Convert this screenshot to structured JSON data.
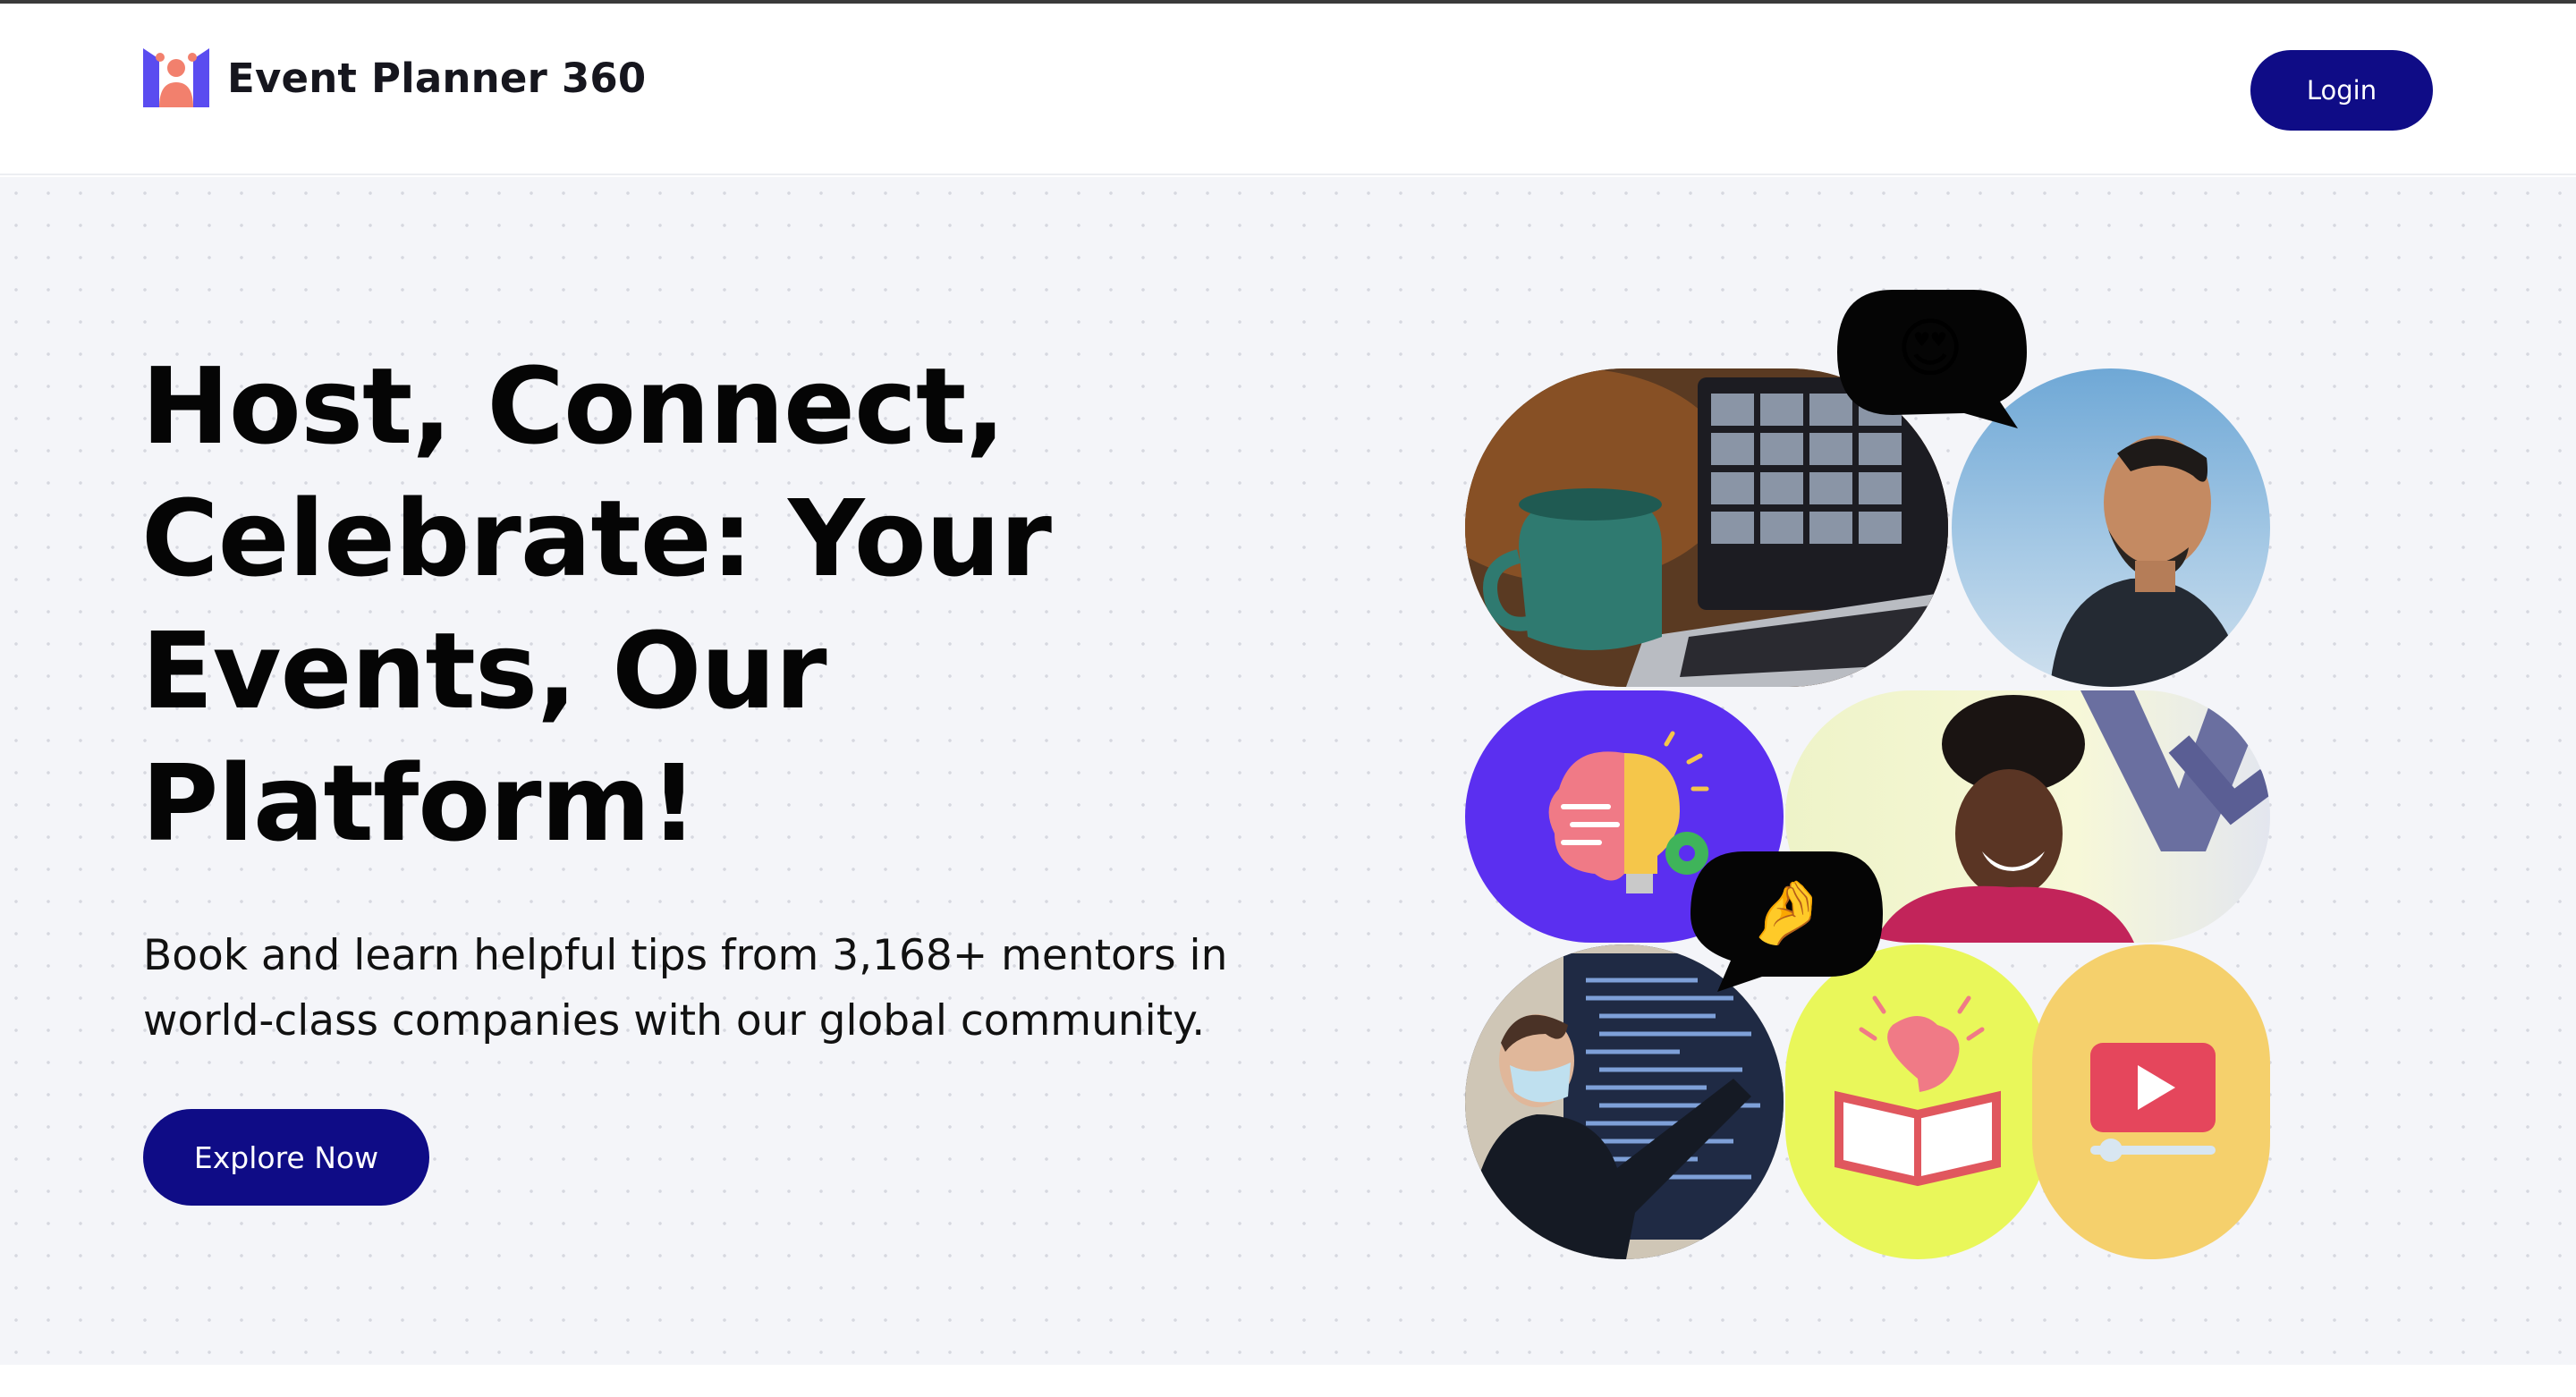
{
  "brand": {
    "name": "Event Planner 360",
    "logo_icon": "people-logo-icon"
  },
  "header": {
    "login_label": "Login"
  },
  "hero": {
    "headline_lines": [
      "Host, Connect,",
      "Celebrate: Your",
      "Events, Our",
      "Platform!"
    ],
    "subtext_lines": [
      "Book and learn helpful tips from 3,168+ mentors in",
      "world-class companies with our global community."
    ],
    "cta_label": "Explore Now"
  },
  "collage": {
    "tiles": [
      {
        "name": "video-call-laptop-photo"
      },
      {
        "name": "laughing-man-photo"
      },
      {
        "name": "brain-lightbulb-icon"
      },
      {
        "name": "smiling-woman-photo"
      },
      {
        "name": "presenter-code-photo"
      },
      {
        "name": "brain-book-icon"
      },
      {
        "name": "video-play-icon"
      }
    ],
    "bubbles": [
      {
        "name": "heart-eyes-emoji-bubble",
        "emoji": "😍"
      },
      {
        "name": "pinching-hand-emoji-bubble",
        "emoji": "🤌"
      }
    ]
  },
  "colors": {
    "primary": "#0f0c86",
    "hero_bg": "#f4f5f9",
    "purple_tile": "#5b2ff0",
    "lime_tile": "#e9f75a",
    "yellow_tile": "#f5d06c",
    "logo_purple": "#5a4cf0",
    "logo_coral": "#f2806d"
  }
}
